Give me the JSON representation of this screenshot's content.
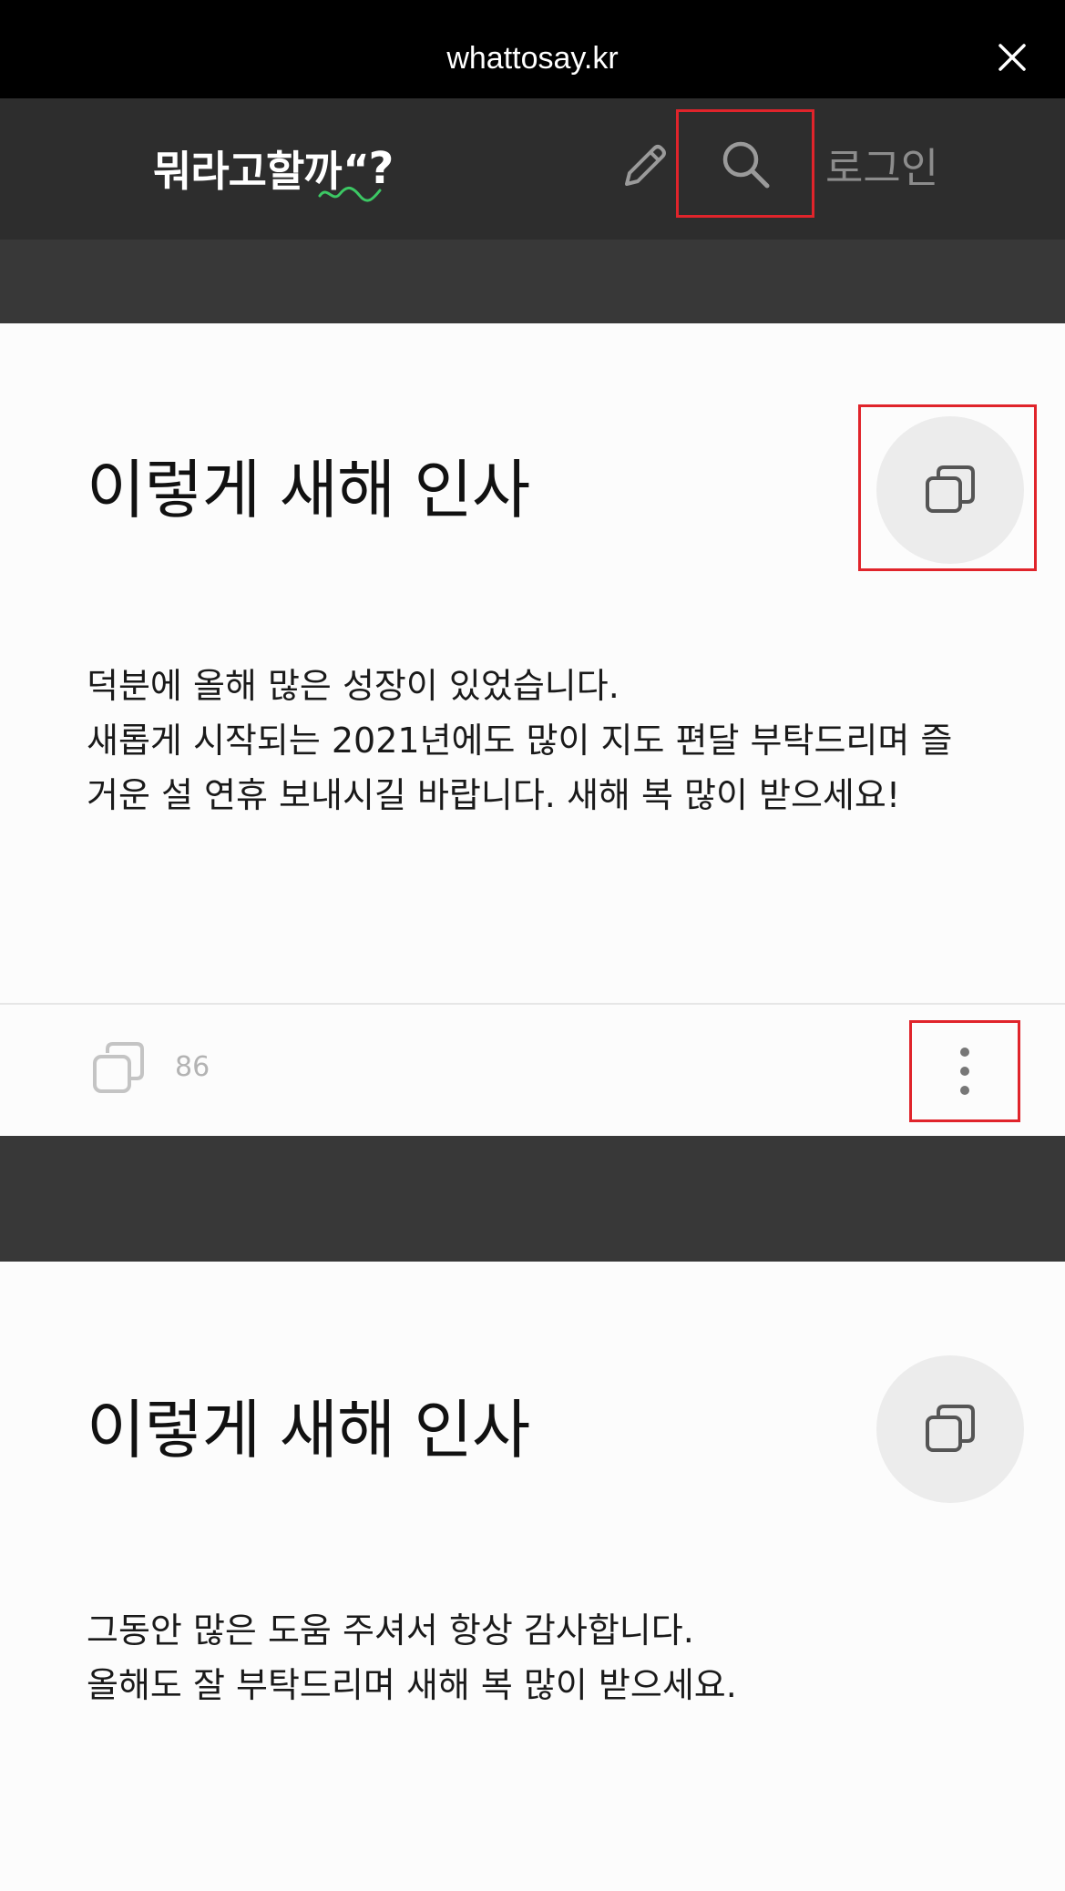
{
  "browser": {
    "url": "whattosay.kr"
  },
  "header": {
    "logo_text": "뭐라고할까",
    "logo_mark": "?",
    "login_label": "로그인"
  },
  "cards": [
    {
      "title": "이렇게 새해 인사",
      "body": "덕분에 올해 많은 성장이 있었습니다.\n새롭게 시작되는 2021년에도 많이 지도 편달 부탁드리며 즐\n거운 설 연휴 보내시길 바랍니다. 새해 복 많이 받으세요!",
      "copy_count": "86"
    },
    {
      "title": "이렇게 새해 인사",
      "body": "그동안 많은 도움 주셔서 항상 감사합니다.\n올해도 잘 부탁드리며 새해 복 많이 받으세요."
    }
  ],
  "colors": {
    "urlbar_bg": "#000000",
    "header_bg": "#2d2d2d",
    "band_bg": "#383838",
    "highlight": "#e0242b",
    "logo_accent": "#3cc864"
  }
}
